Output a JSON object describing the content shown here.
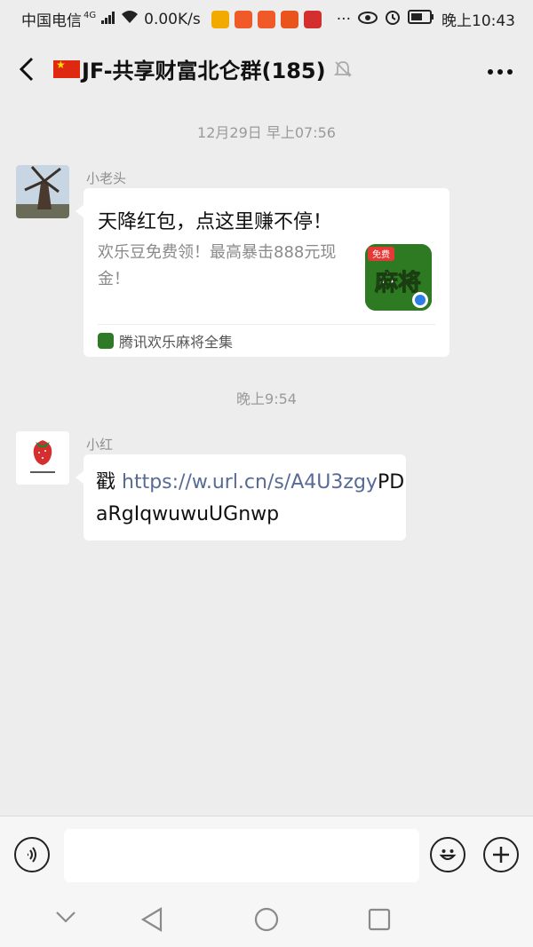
{
  "status_bar": {
    "carrier": "中国电信",
    "network": "4G",
    "speed": "0.00K/s",
    "time": "晚上10:43",
    "overflow": "···"
  },
  "header": {
    "title": "JF-共享财富北仑群(185)",
    "back_icon": "back-chevron-icon",
    "mute_icon": "bell-off-icon",
    "more_icon": "more-dots-icon"
  },
  "messages": {
    "time1": "12月29日 早上07:56",
    "msg1": {
      "sender": "小老头",
      "card_title": "天降红包，点这里赚不停！",
      "card_desc": "欢乐豆免费领！最高暴击888元现金！",
      "thumb_top": "免费",
      "thumb_main": "麻将",
      "source": "腾讯欢乐麻将全集"
    },
    "time2": "晚上9:54",
    "msg2": {
      "sender": "小红",
      "prefix": "戳 ",
      "link": "https://w.url.cn/s/A4U3zgy",
      "suffix": "PDaRgIqwuwuUGnwp"
    }
  },
  "input_bar": {
    "voice_icon": "voice-icon",
    "emoji_icon": "emoji-icon",
    "plus_icon": "plus-icon",
    "input_value": ""
  },
  "system_nav": {
    "icons": [
      "chevron-down-icon",
      "back-triangle-icon",
      "home-circle-icon",
      "recents-square-icon"
    ]
  },
  "colors": {
    "background": "#ededed",
    "link": "#576b95",
    "timestamp": "#9a9a9a"
  }
}
